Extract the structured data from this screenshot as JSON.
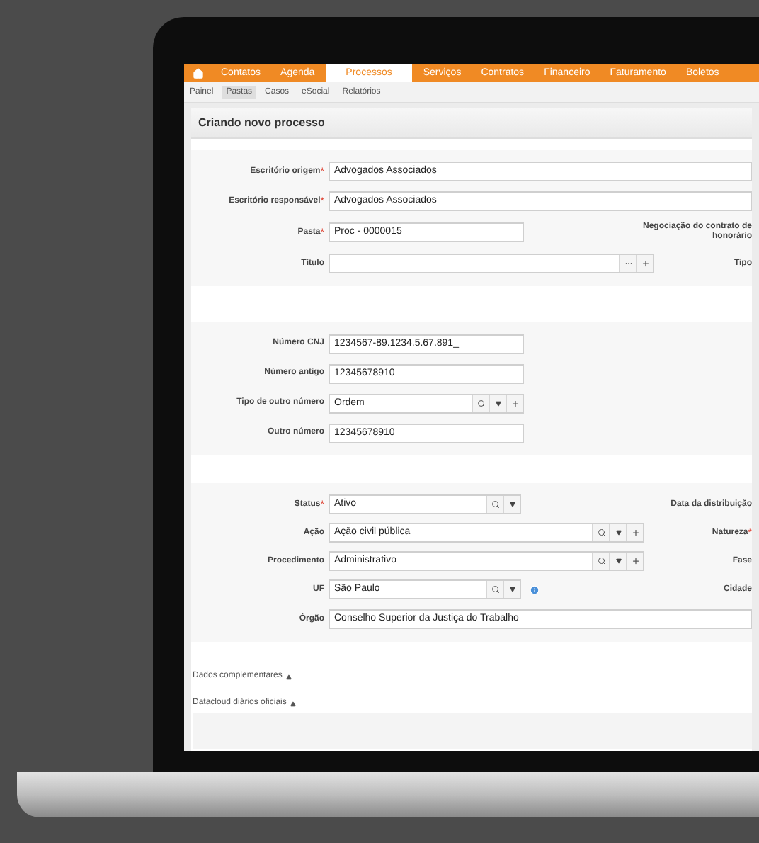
{
  "nav": {
    "items": [
      {
        "label": "Contatos",
        "selected": false
      },
      {
        "label": "Agenda",
        "selected": false
      },
      {
        "label": "Processos",
        "selected": true
      },
      {
        "label": "Serviços",
        "selected": false
      },
      {
        "label": "Contratos",
        "selected": false
      },
      {
        "label": "Financeiro",
        "selected": false
      },
      {
        "label": "Faturamento",
        "selected": false
      },
      {
        "label": "Boletos",
        "selected": false
      }
    ]
  },
  "subnav": {
    "items": [
      {
        "label": "Painel",
        "selected": false
      },
      {
        "label": "Pastas",
        "selected": true
      },
      {
        "label": "Casos",
        "selected": false
      },
      {
        "label": "eSocial",
        "selected": false
      },
      {
        "label": "Relatórios",
        "selected": false
      }
    ]
  },
  "page_title": "Criando novo processo",
  "sections": [
    {
      "rows": [
        {
          "label": "Escritório origem",
          "required_mark": "*",
          "value": "Advogados Associados",
          "buttons": []
        },
        {
          "label": "Escritório responsável",
          "required_mark": "*",
          "value": "Advogados Associados",
          "buttons": []
        },
        {
          "label": "Pasta",
          "required_mark": "*",
          "value": "Proc - 0000015",
          "buttons": [],
          "side_label": {
            "text": "Negociação do contrato de honorário"
          }
        },
        {
          "label": "Título",
          "buttons": [
            {
              "kind": "more"
            },
            {
              "kind": "add"
            }
          ],
          "side_label": {
            "text": "Tipo"
          }
        }
      ]
    },
    {
      "rows": [
        {
          "label": "Número CNJ",
          "value": "1234567-89.1234.5.67.891_",
          "buttons": []
        },
        {
          "label": "Número antigo",
          "value": "12345678910",
          "buttons": []
        },
        {
          "label": "Tipo de outro número",
          "value": "Ordem",
          "buttons": [
            {
              "kind": "search"
            },
            {
              "kind": "dropdown"
            },
            {
              "kind": "add"
            }
          ]
        },
        {
          "label": "Outro número",
          "value": "12345678910",
          "buttons": []
        }
      ]
    },
    {
      "rows": [
        {
          "label": "Status",
          "required_mark": "*",
          "value": "Ativo",
          "buttons": [
            {
              "kind": "search"
            },
            {
              "kind": "dropdown"
            }
          ],
          "side_label": {
            "text": "Data da distribuição"
          }
        },
        {
          "label": "Ação",
          "value": "Ação civil pública",
          "buttons": [
            {
              "kind": "search"
            },
            {
              "kind": "dropdown"
            },
            {
              "kind": "add"
            }
          ],
          "side_label": {
            "text": "Natureza",
            "required_mark": "*"
          }
        },
        {
          "label": "Procedimento",
          "value": "Administrativo",
          "buttons": [
            {
              "kind": "search"
            },
            {
              "kind": "dropdown"
            },
            {
              "kind": "add"
            }
          ],
          "side_label": {
            "text": "Fase"
          }
        },
        {
          "label": "UF",
          "value": "São Paulo",
          "buttons": [
            {
              "kind": "search"
            },
            {
              "kind": "dropdown"
            }
          ],
          "info": true,
          "side_label": {
            "text": "Cidade"
          }
        },
        {
          "label": "Órgão",
          "value": "Conselho Superior da Justiça do Trabalho",
          "buttons": []
        }
      ]
    }
  ],
  "panels": [
    {
      "title": "Dados complementares",
      "expanded": false
    },
    {
      "title": "Datacloud diários oficiais",
      "expanded": false
    }
  ]
}
